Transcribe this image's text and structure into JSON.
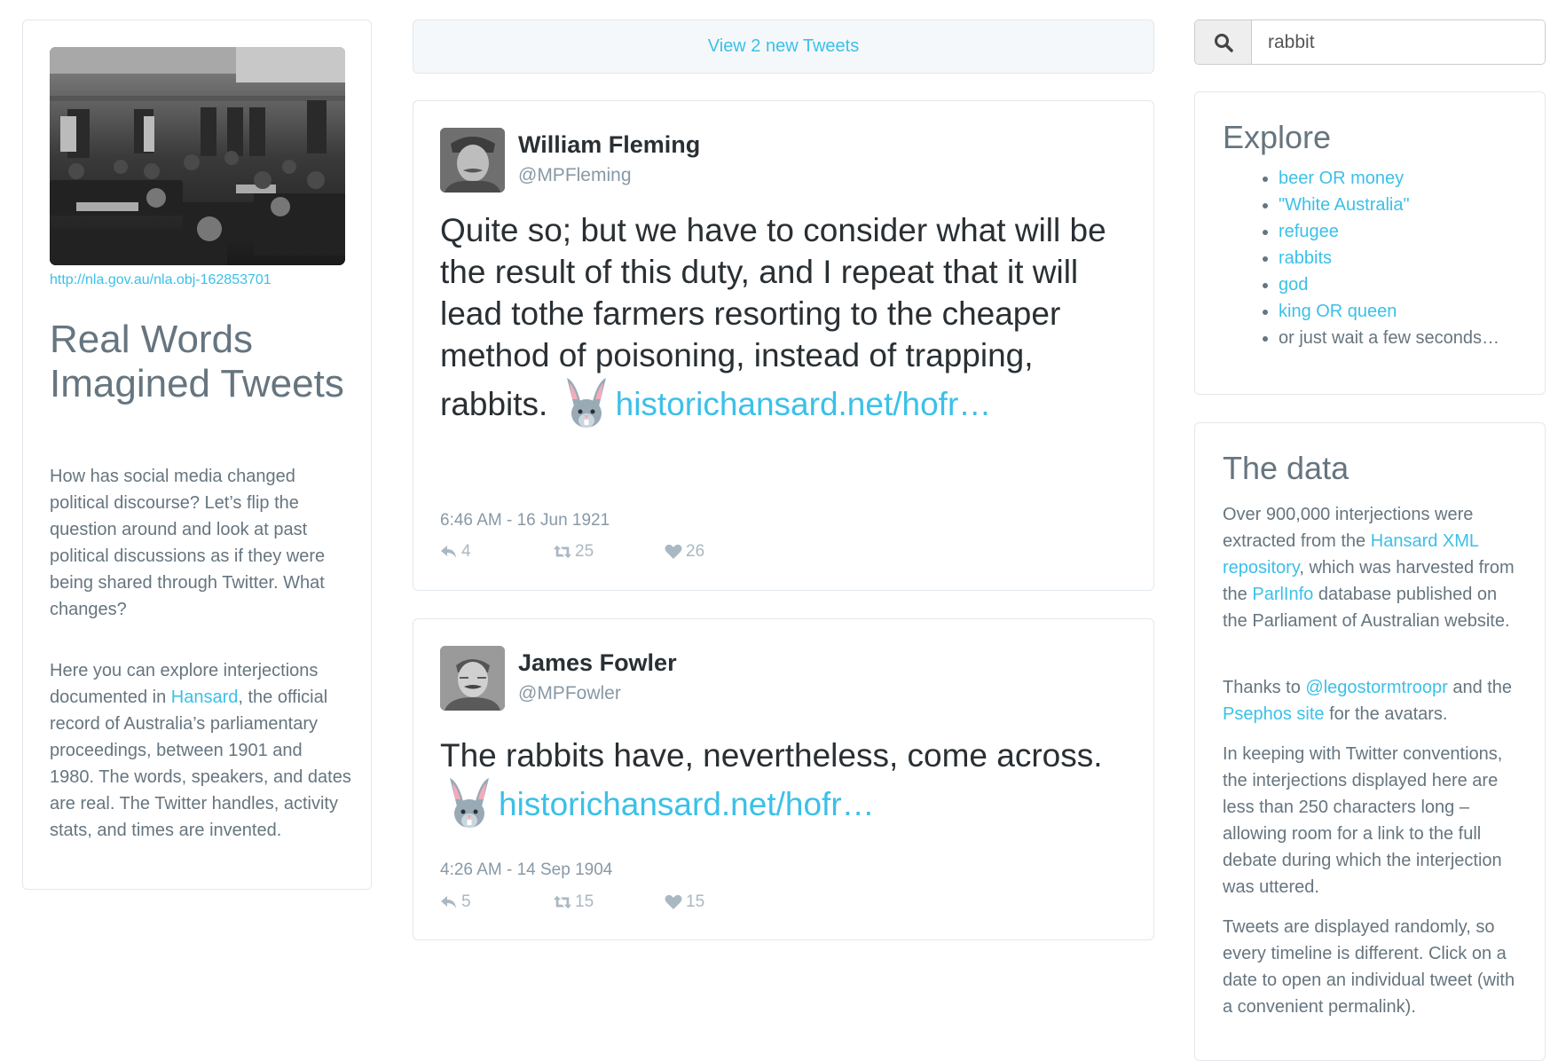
{
  "left": {
    "photo_alt": "Historic photograph of Australian House of Representatives chamber",
    "photo_credit": "http://nla.gov.au/nla.obj-162853701",
    "title": "Real Words Imagined Tweets",
    "intro_p1": "How has social media changed political discourse? Let’s flip the question around and look at past political discussions as if they were being shared through Twitter. What changes?",
    "intro_p2_before": "Here you can explore interjections documented in ",
    "intro_p2_link": "Hansard",
    "intro_p2_after": ", the official record of Australia’s parliamentary proceedings, between 1901 and 1980. The words, speakers, and dates are real. The Twitter handles, activity stats, and times are invented."
  },
  "timeline": {
    "new_tweets_label": "View 2 new Tweets",
    "tweets": [
      {
        "name": "William Fleming",
        "handle": "@MPFleming",
        "text": "Quite so; but we have to consider what will be the result of this duty, and I repeat that it will lead tothe farmers resorting to the cheaper method of poisoning, instead of trapping, rabbits.",
        "emoji": "rabbit-face",
        "link": "historichansard.net/hofr…",
        "date": "6:46 AM - 16 Jun 1921",
        "replies": "4",
        "retweets": "25",
        "likes": "26"
      },
      {
        "name": "James Fowler",
        "handle": "@MPFowler",
        "text": "The rabbits have, nevertheless, come across.",
        "emoji": "rabbit-face",
        "link": "historichansard.net/hofr…",
        "date": "4:26 AM - 14 Sep 1904",
        "replies": "5",
        "retweets": "15",
        "likes": "15"
      }
    ]
  },
  "search": {
    "value": "rabbit",
    "icon": "search-icon"
  },
  "explore": {
    "heading": "Explore",
    "items": [
      {
        "label": "beer OR money",
        "link": true
      },
      {
        "label": "\"White Australia\"",
        "link": true
      },
      {
        "label": "refugee",
        "link": true
      },
      {
        "label": "rabbits",
        "link": true
      },
      {
        "label": "god",
        "link": true
      },
      {
        "label": "king OR queen",
        "link": true
      },
      {
        "label": "or just wait a few seconds…",
        "link": false
      }
    ]
  },
  "data_section": {
    "heading": "The data",
    "p1_a": "Over 900,000 interjections were extracted from the ",
    "p1_link1": "Hansard XML repository",
    "p1_b": ", which was harvested from the ",
    "p1_link2": "ParlInfo",
    "p1_c": " database published on the Parliament of Australian website.",
    "p2_a": "Thanks to ",
    "p2_link1": "@legostormtroopr",
    "p2_b": " and the ",
    "p2_link2": "Psephos site",
    "p2_c": " for the avatars.",
    "p3": "In keeping with Twitter conventions, the interjections displayed here are less than 250 characters long – allowing room for a link to the full debate during which the interjection was uttered.",
    "p4": "Tweets are displayed randomly, so every timeline is different. Click on a date to open an individual tweet (with a convenient permalink)."
  },
  "colors": {
    "link": "#3bc0e8",
    "text": "#66757f",
    "tweet_text": "#292f33",
    "meta": "#8899a6",
    "border": "#e1e8ed"
  }
}
